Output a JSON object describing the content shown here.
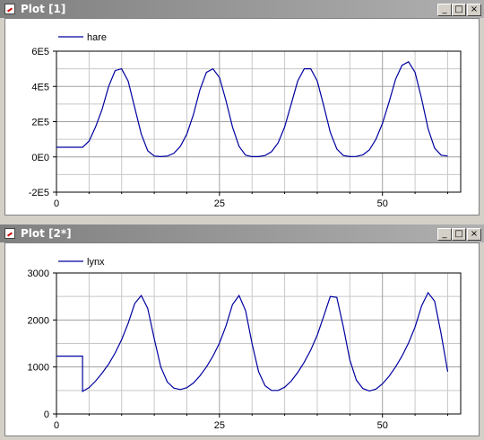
{
  "plots": [
    {
      "title": "Plot [1]",
      "buttons": {
        "minimize": "_",
        "maximize": "□",
        "close": "×"
      },
      "chart_data": {
        "type": "line",
        "series": [
          {
            "name": "hare",
            "color": "#0000a0",
            "points": [
              [
                0,
                55000
              ],
              [
                4,
                55000
              ],
              [
                5,
                90000
              ],
              [
                6,
                170000
              ],
              [
                7,
                270000
              ],
              [
                8,
                400000
              ],
              [
                9,
                490000
              ],
              [
                10,
                500000
              ],
              [
                11,
                430000
              ],
              [
                12,
                280000
              ],
              [
                13,
                130000
              ],
              [
                14,
                35000
              ],
              [
                15,
                5000
              ],
              [
                16,
                2000
              ],
              [
                17,
                5000
              ],
              [
                18,
                20000
              ],
              [
                19,
                60000
              ],
              [
                20,
                130000
              ],
              [
                21,
                240000
              ],
              [
                22,
                380000
              ],
              [
                23,
                480000
              ],
              [
                24,
                500000
              ],
              [
                25,
                450000
              ],
              [
                26,
                320000
              ],
              [
                27,
                170000
              ],
              [
                28,
                60000
              ],
              [
                29,
                10000
              ],
              [
                30,
                2000
              ],
              [
                31,
                2000
              ],
              [
                32,
                8000
              ],
              [
                33,
                30000
              ],
              [
                34,
                80000
              ],
              [
                35,
                170000
              ],
              [
                36,
                300000
              ],
              [
                37,
                430000
              ],
              [
                38,
                500000
              ],
              [
                39,
                500000
              ],
              [
                40,
                430000
              ],
              [
                41,
                290000
              ],
              [
                42,
                140000
              ],
              [
                43,
                45000
              ],
              [
                44,
                8000
              ],
              [
                45,
                2000
              ],
              [
                46,
                3000
              ],
              [
                47,
                12000
              ],
              [
                48,
                40000
              ],
              [
                49,
                100000
              ],
              [
                50,
                190000
              ],
              [
                51,
                310000
              ],
              [
                52,
                440000
              ],
              [
                53,
                520000
              ],
              [
                54,
                540000
              ],
              [
                55,
                480000
              ],
              [
                56,
                330000
              ],
              [
                57,
                160000
              ],
              [
                58,
                50000
              ],
              [
                59,
                10000
              ],
              [
                60,
                5000
              ]
            ]
          }
        ],
        "xticks": [
          "0",
          "25",
          "50"
        ],
        "xlim": [
          0,
          62
        ],
        "yticks": [
          "-2E5",
          "0E0",
          "2E5",
          "4E5",
          "6E5"
        ],
        "ylim": [
          -200000,
          600000
        ],
        "grid": true,
        "legend": "top-left"
      }
    },
    {
      "title": "Plot [2*]",
      "buttons": {
        "minimize": "_",
        "maximize": "□",
        "close": "×"
      },
      "chart_data": {
        "type": "line",
        "series": [
          {
            "name": "lynx",
            "color": "#0000a0",
            "points": [
              [
                0,
                1230
              ],
              [
                4,
                1230
              ],
              [
                4,
                480
              ],
              [
                5,
                560
              ],
              [
                6,
                700
              ],
              [
                7,
                870
              ],
              [
                8,
                1060
              ],
              [
                9,
                1300
              ],
              [
                10,
                1580
              ],
              [
                11,
                1930
              ],
              [
                12,
                2350
              ],
              [
                13,
                2520
              ],
              [
                14,
                2250
              ],
              [
                15,
                1600
              ],
              [
                16,
                1000
              ],
              [
                17,
                680
              ],
              [
                18,
                550
              ],
              [
                19,
                520
              ],
              [
                20,
                560
              ],
              [
                21,
                660
              ],
              [
                22,
                810
              ],
              [
                23,
                1000
              ],
              [
                24,
                1230
              ],
              [
                25,
                1510
              ],
              [
                26,
                1870
              ],
              [
                27,
                2330
              ],
              [
                28,
                2520
              ],
              [
                29,
                2200
              ],
              [
                30,
                1500
              ],
              [
                31,
                900
              ],
              [
                32,
                600
              ],
              [
                33,
                500
              ],
              [
                34,
                500
              ],
              [
                35,
                570
              ],
              [
                36,
                700
              ],
              [
                37,
                880
              ],
              [
                38,
                1100
              ],
              [
                39,
                1360
              ],
              [
                40,
                1680
              ],
              [
                41,
                2080
              ],
              [
                42,
                2500
              ],
              [
                43,
                2480
              ],
              [
                44,
                1850
              ],
              [
                45,
                1150
              ],
              [
                46,
                720
              ],
              [
                47,
                540
              ],
              [
                48,
                490
              ],
              [
                49,
                530
              ],
              [
                50,
                640
              ],
              [
                51,
                800
              ],
              [
                52,
                1000
              ],
              [
                53,
                1230
              ],
              [
                54,
                1510
              ],
              [
                55,
                1850
              ],
              [
                56,
                2300
              ],
              [
                57,
                2580
              ],
              [
                58,
                2400
              ],
              [
                59,
                1700
              ],
              [
                60,
                900
              ]
            ]
          }
        ],
        "xticks": [
          "0",
          "25",
          "50"
        ],
        "xlim": [
          0,
          62
        ],
        "yticks": [
          "0",
          "1000",
          "2000",
          "3000"
        ],
        "ylim": [
          0,
          3000
        ],
        "grid": true,
        "legend": "top-left"
      }
    }
  ]
}
